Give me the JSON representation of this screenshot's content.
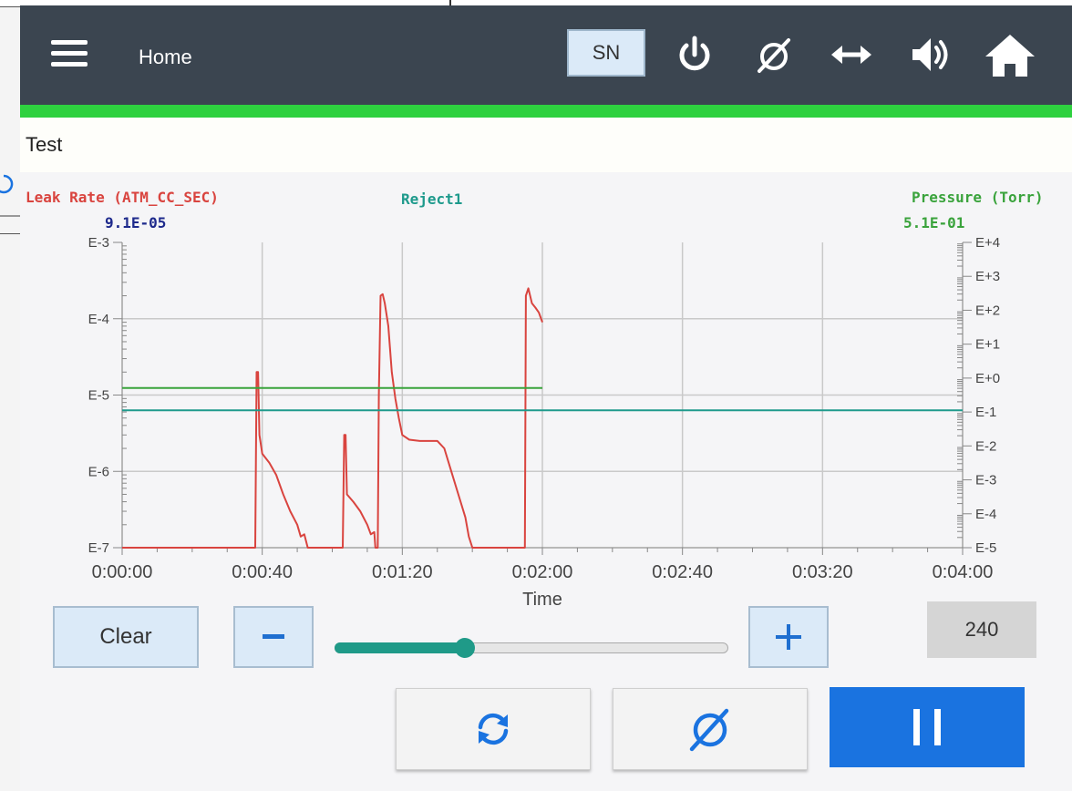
{
  "header": {
    "title": "Home",
    "sn_label": "SN",
    "icons": [
      "menu-icon",
      "power-icon",
      "null-icon",
      "horizontal-arrows-icon",
      "speaker-icon",
      "home-icon"
    ]
  },
  "section": {
    "title": "Test"
  },
  "chart_labels": {
    "left_series": "Leak Rate (ATM_CC_SEC)",
    "left_value": "9.1E-05",
    "center_series": "Reject1",
    "right_series": "Pressure (Torr)",
    "right_value": "5.1E-01"
  },
  "chart_data": {
    "type": "line",
    "xlabel": "Time",
    "x_ticks": [
      "0:00:00",
      "0:00:40",
      "0:01:20",
      "0:02:00",
      "0:02:40",
      "0:03:20",
      "0:04:00"
    ],
    "x_range_seconds": [
      0,
      240
    ],
    "y_left_ticks": [
      "E-3",
      "E-4",
      "E-5",
      "E-6",
      "E-7"
    ],
    "y_left_log_range": [
      -7,
      -3
    ],
    "y_right_ticks": [
      "E+4",
      "E+3",
      "E+2",
      "E+1",
      "E+0",
      "E-1",
      "E-2",
      "E-3",
      "E-4",
      "E-5"
    ],
    "y_right_log_range": [
      -5,
      4
    ],
    "grid": true,
    "colors": {
      "leak": "#d9443f",
      "pressure": "#3aa33c",
      "reject": "#1e9a8c"
    },
    "series": [
      {
        "name": "Leak Rate (ATM_CC_SEC)",
        "axis": "left",
        "points": [
          [
            0,
            1e-07
          ],
          [
            38,
            1e-07
          ],
          [
            38.4,
            2e-05
          ],
          [
            38.8,
            2e-05
          ],
          [
            39.2,
            3e-06
          ],
          [
            40,
            1.7e-06
          ],
          [
            42,
            1.3e-06
          ],
          [
            44,
            9e-07
          ],
          [
            46,
            5e-07
          ],
          [
            48,
            3e-07
          ],
          [
            50,
            2e-07
          ],
          [
            51,
            1.4e-07
          ],
          [
            52,
            1.5e-07
          ],
          [
            53,
            1e-07
          ],
          [
            63,
            1e-07
          ],
          [
            63.4,
            3e-06
          ],
          [
            63.8,
            3e-06
          ],
          [
            64.2,
            5e-07
          ],
          [
            66,
            4e-07
          ],
          [
            68,
            3e-07
          ],
          [
            70,
            2e-07
          ],
          [
            71,
            1.5e-07
          ],
          [
            72,
            1.6e-07
          ],
          [
            72.3,
            1e-07
          ],
          [
            73,
            1e-07
          ],
          [
            73.3,
            1e-05
          ],
          [
            73.8,
            0.0002
          ],
          [
            74.4,
            0.00021
          ],
          [
            75,
            0.00016
          ],
          [
            76,
            8e-05
          ],
          [
            77,
            2e-05
          ],
          [
            78,
            9e-06
          ],
          [
            79,
            5e-06
          ],
          [
            80,
            3e-06
          ],
          [
            82,
            2.6e-06
          ],
          [
            85,
            2.5e-06
          ],
          [
            90,
            2.5e-06
          ],
          [
            92,
            2e-06
          ],
          [
            94,
            1e-06
          ],
          [
            96,
            5e-07
          ],
          [
            98,
            2.5e-07
          ],
          [
            99,
            1.4e-07
          ],
          [
            100,
            1e-07
          ],
          [
            115,
            1e-07
          ],
          [
            115.3,
            0.0002
          ],
          [
            116,
            0.00025
          ],
          [
            117,
            0.00016
          ],
          [
            118,
            0.00014
          ],
          [
            119,
            0.00012
          ],
          [
            120,
            9e-05
          ]
        ]
      },
      {
        "name": "Pressure (Torr)",
        "axis": "right",
        "points": [
          [
            0,
            0.51
          ],
          [
            120,
            0.51
          ]
        ]
      },
      {
        "name": "Reject1",
        "axis": "left",
        "points": [
          [
            0,
            6.3e-06
          ],
          [
            240,
            6.3e-06
          ]
        ]
      }
    ]
  },
  "controls": {
    "clear_label": "Clear",
    "minus_label": "−",
    "plus_label": "+",
    "zoom_fraction": 0.33,
    "time_window": "240"
  },
  "actions": {
    "refresh_icon": "refresh-icon",
    "null_icon": "null-icon",
    "pause_icon": "pause-icon"
  }
}
